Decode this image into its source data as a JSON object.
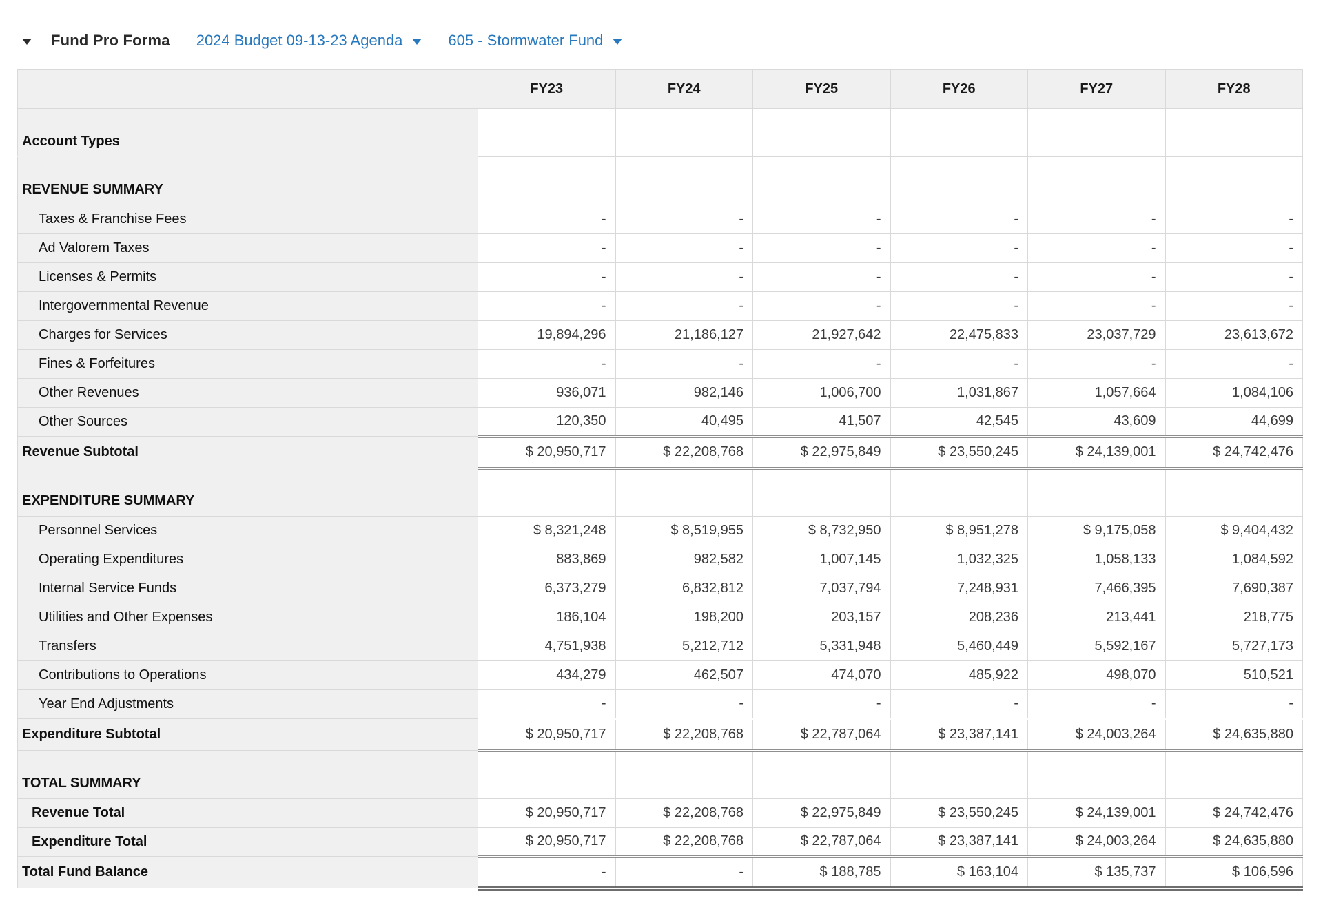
{
  "header": {
    "title": "Fund Pro Forma",
    "collapse_icon": "triangle-down",
    "budget_dropdown": {
      "label": "2024 Budget 09-13-23 Agenda",
      "icon": "caret-down"
    },
    "fund_dropdown": {
      "label": "605 - Stormwater Fund",
      "icon": "caret-down"
    }
  },
  "table": {
    "columns": [
      "FY23",
      "FY24",
      "FY25",
      "FY26",
      "FY27",
      "FY28"
    ],
    "rows": [
      {
        "kind": "section",
        "key": "account-types",
        "label": "Account Types",
        "values": [
          "",
          "",
          "",
          "",
          "",
          ""
        ]
      },
      {
        "kind": "section",
        "key": "revenue-summary",
        "label": "REVENUE SUMMARY",
        "values": [
          "",
          "",
          "",
          "",
          "",
          ""
        ]
      },
      {
        "kind": "detail",
        "key": "taxes-franchise-fees",
        "label": "Taxes & Franchise Fees",
        "values": [
          "-",
          "-",
          "-",
          "-",
          "-",
          "-"
        ]
      },
      {
        "kind": "detail",
        "key": "ad-valorem-taxes",
        "label": "Ad Valorem Taxes",
        "values": [
          "-",
          "-",
          "-",
          "-",
          "-",
          "-"
        ]
      },
      {
        "kind": "detail",
        "key": "licenses-permits",
        "label": "Licenses & Permits",
        "values": [
          "-",
          "-",
          "-",
          "-",
          "-",
          "-"
        ]
      },
      {
        "kind": "detail",
        "key": "intergovernmental",
        "label": "Intergovernmental Revenue",
        "values": [
          "-",
          "-",
          "-",
          "-",
          "-",
          "-"
        ]
      },
      {
        "kind": "detail",
        "key": "charges-for-services",
        "label": "Charges for Services",
        "values": [
          "19,894,296",
          "21,186,127",
          "21,927,642",
          "22,475,833",
          "23,037,729",
          "23,613,672"
        ]
      },
      {
        "kind": "detail",
        "key": "fines-forfeitures",
        "label": "Fines & Forfeitures",
        "values": [
          "-",
          "-",
          "-",
          "-",
          "-",
          "-"
        ]
      },
      {
        "kind": "detail",
        "key": "other-revenues",
        "label": "Other Revenues",
        "values": [
          "936,071",
          "982,146",
          "1,006,700",
          "1,031,867",
          "1,057,664",
          "1,084,106"
        ]
      },
      {
        "kind": "detail",
        "key": "other-sources",
        "label": "Other Sources",
        "values": [
          "120,350",
          "40,495",
          "41,507",
          "42,545",
          "43,609",
          "44,699"
        ]
      },
      {
        "kind": "subtotal",
        "key": "revenue-subtotal",
        "label": "Revenue Subtotal",
        "values": [
          "$ 20,950,717",
          "$ 22,208,768",
          "$ 22,975,849",
          "$ 23,550,245",
          "$ 24,139,001",
          "$ 24,742,476"
        ]
      },
      {
        "kind": "section",
        "key": "expenditure-summary",
        "label": "EXPENDITURE SUMMARY",
        "values": [
          "",
          "",
          "",
          "",
          "",
          ""
        ]
      },
      {
        "kind": "detail",
        "key": "personnel-services",
        "label": "Personnel Services",
        "values": [
          "$ 8,321,248",
          "$ 8,519,955",
          "$ 8,732,950",
          "$ 8,951,278",
          "$ 9,175,058",
          "$ 9,404,432"
        ]
      },
      {
        "kind": "detail",
        "key": "operating-expenditures",
        "label": "Operating Expenditures",
        "values": [
          "883,869",
          "982,582",
          "1,007,145",
          "1,032,325",
          "1,058,133",
          "1,084,592"
        ]
      },
      {
        "kind": "detail",
        "key": "internal-service-funds",
        "label": "Internal Service Funds",
        "values": [
          "6,373,279",
          "6,832,812",
          "7,037,794",
          "7,248,931",
          "7,466,395",
          "7,690,387"
        ]
      },
      {
        "kind": "detail",
        "key": "utilities-other",
        "label": "Utilities and Other Expenses",
        "values": [
          "186,104",
          "198,200",
          "203,157",
          "208,236",
          "213,441",
          "218,775"
        ]
      },
      {
        "kind": "detail",
        "key": "transfers",
        "label": "Transfers",
        "values": [
          "4,751,938",
          "5,212,712",
          "5,331,948",
          "5,460,449",
          "5,592,167",
          "5,727,173"
        ]
      },
      {
        "kind": "detail",
        "key": "contributions",
        "label": "Contributions to Operations",
        "values": [
          "434,279",
          "462,507",
          "474,070",
          "485,922",
          "498,070",
          "510,521"
        ]
      },
      {
        "kind": "detail",
        "key": "year-end-adjustments",
        "label": "Year End Adjustments",
        "values": [
          "-",
          "-",
          "-",
          "-",
          "-",
          "-"
        ]
      },
      {
        "kind": "subtotal",
        "key": "expenditure-subtotal",
        "label": "Expenditure Subtotal",
        "values": [
          "$ 20,950,717",
          "$ 22,208,768",
          "$ 22,787,064",
          "$ 23,387,141",
          "$ 24,003,264",
          "$ 24,635,880"
        ]
      },
      {
        "kind": "section",
        "key": "total-summary",
        "label": "TOTAL SUMMARY",
        "values": [
          "",
          "",
          "",
          "",
          "",
          ""
        ]
      },
      {
        "kind": "total",
        "key": "revenue-total",
        "label": "Revenue Total",
        "values": [
          "$ 20,950,717",
          "$ 22,208,768",
          "$ 22,975,849",
          "$ 23,550,245",
          "$ 24,139,001",
          "$ 24,742,476"
        ]
      },
      {
        "kind": "total",
        "key": "expenditure-total",
        "label": "Expenditure Total",
        "values": [
          "$ 20,950,717",
          "$ 22,208,768",
          "$ 22,787,064",
          "$ 23,387,141",
          "$ 24,003,264",
          "$ 24,635,880"
        ]
      },
      {
        "kind": "grand",
        "key": "total-fund-balance",
        "label": "Total Fund Balance",
        "values": [
          "-",
          "-",
          "$ 188,785",
          "$ 163,104",
          "$ 135,737",
          "$ 106,596"
        ]
      }
    ]
  },
  "colors": {
    "link_blue": "#2878bd",
    "header_gray": "#f0f0f0",
    "border_gray": "#d9d9d9",
    "rule_gray": "#8f8f8f",
    "text_dark": "#1a1a1a"
  }
}
